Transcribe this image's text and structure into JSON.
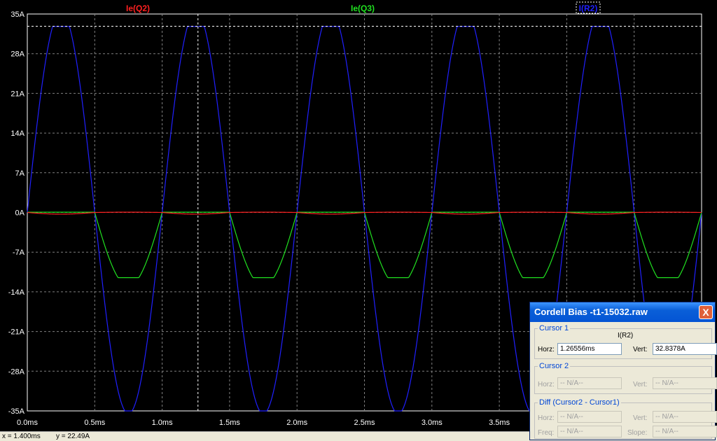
{
  "plot": {
    "traces": [
      {
        "name": "Ie(Q2)",
        "color": "#ff2020"
      },
      {
        "name": "Ie(Q3)",
        "color": "#20e020"
      },
      {
        "name": "I(R2)",
        "color": "#2020ff"
      }
    ],
    "y_ticks": [
      "35A",
      "28A",
      "21A",
      "14A",
      "7A",
      "0A",
      "-7A",
      "-14A",
      "-21A",
      "-28A",
      "-35A"
    ],
    "x_ticks": [
      "0.0ms",
      "0.5ms",
      "1.0ms",
      "1.5ms",
      "2.0ms",
      "2.5ms",
      "3.0ms",
      "3.5ms"
    ]
  },
  "chart_data": {
    "type": "line",
    "xlabel": "",
    "ylabel": "",
    "x_unit": "ms",
    "y_unit": "A",
    "xlim": [
      0,
      5
    ],
    "ylim": [
      -35,
      35
    ],
    "grid": true,
    "series": [
      {
        "name": "I(R2)",
        "color": "#2020ff",
        "shape": "sine, clipped at peaks",
        "period_ms": 1.0,
        "amplitude_A": 32.8,
        "peak_A": 32.8,
        "trough_A": -35
      },
      {
        "name": "Ie(Q3)",
        "color": "#20e020",
        "shape": "negative half-wave, clipped",
        "period_ms": 1.0,
        "min_A": -11.5,
        "max_A": 0
      },
      {
        "name": "Ie(Q2)",
        "color": "#ff2020",
        "shape": "near-zero",
        "period_ms": 1.0,
        "min_A": -0.3,
        "max_A": 0.1
      }
    ],
    "cursor": {
      "x_ms": 1.26556,
      "y_A": 32.8378
    }
  },
  "status": {
    "x_readout": "x = 1.400ms",
    "y_readout": "y = 22.49A"
  },
  "dialog": {
    "title": "Cordell Bias -t1-15032.raw",
    "close_label": "X",
    "cursor1": {
      "group_title": "Cursor 1",
      "trace_name": "I(R2)",
      "horz_label": "Horz:",
      "horz_value": "1.26556ms",
      "vert_label": "Vert:",
      "vert_value": "32.8378A"
    },
    "cursor2": {
      "group_title": "Cursor 2",
      "horz_label": "Horz:",
      "horz_value": "-- N/A--",
      "vert_label": "Vert:",
      "vert_value": "-- N/A--"
    },
    "diff": {
      "group_title": "Diff (Cursor2 - Cursor1)",
      "horz_label": "Horz:",
      "horz_value": "-- N/A--",
      "vert_label": "Vert:",
      "vert_value": "-- N/A--",
      "freq_label": "Freq:",
      "freq_value": "-- N/A--",
      "slope_label": "Slope:",
      "slope_value": "-- N/A--"
    }
  }
}
